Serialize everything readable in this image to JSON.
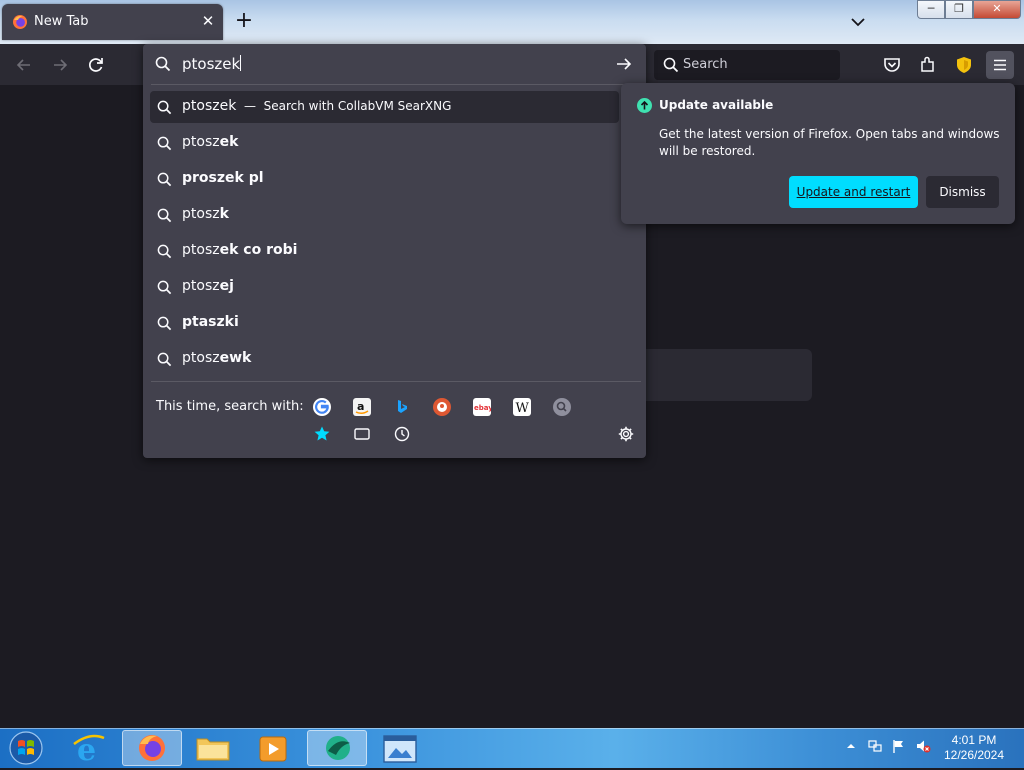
{
  "browser": {
    "tab": {
      "title": "New Tab"
    },
    "window_controls": {
      "minimize": "─",
      "maximize": "❐",
      "close": "✕"
    },
    "new_tab_symbol": "+"
  },
  "urlbar": {
    "value": "ptoszek",
    "results": [
      {
        "type": "search-action",
        "prefix": "ptoszek",
        "bold": "",
        "separator": "—",
        "action": "Search with CollabVM SearXNG",
        "selected": true
      },
      {
        "type": "suggestion",
        "prefix": "ptosz",
        "bold": "ek"
      },
      {
        "type": "suggestion",
        "prefix": "",
        "bold": "proszek pl"
      },
      {
        "type": "suggestion",
        "prefix": "ptosz",
        "bold": "k"
      },
      {
        "type": "suggestion",
        "prefix": "ptosz",
        "bold": "ek co robi"
      },
      {
        "type": "suggestion",
        "prefix": "ptosz",
        "bold": "ej"
      },
      {
        "type": "suggestion",
        "prefix": "",
        "bold": "ptaszki"
      },
      {
        "type": "suggestion",
        "prefix": "ptosz",
        "bold": "ewk"
      }
    ],
    "one_off": {
      "label": "This time, search with:",
      "engines": [
        {
          "name": "google",
          "icon": "google-icon"
        },
        {
          "name": "amazon",
          "icon": "amazon-icon"
        },
        {
          "name": "bing",
          "icon": "bing-icon"
        },
        {
          "name": "duckduckgo",
          "icon": "duckduckgo-icon"
        },
        {
          "name": "ebay",
          "icon": "ebay-icon",
          "glyph": "ebay"
        },
        {
          "name": "wikipedia",
          "icon": "wikipedia-icon",
          "glyph": "W"
        },
        {
          "name": "searxng",
          "icon": "searxng-icon"
        }
      ],
      "modes": [
        {
          "name": "bookmarks",
          "icon": "star-icon"
        },
        {
          "name": "tabs",
          "icon": "tabs-icon"
        },
        {
          "name": "history",
          "icon": "clock-icon"
        }
      ],
      "settings_icon": "gear-icon"
    }
  },
  "searchbar": {
    "placeholder": "Search"
  },
  "update_doorhanger": {
    "title": "Update available",
    "message": "Get the latest version of Firefox. Open tabs and windows will be restored.",
    "primary": "Update and restart",
    "secondary": "Dismiss"
  },
  "taskbar": {
    "items": [
      "internet-explorer",
      "firefox",
      "file-explorer",
      "media-player",
      "collabvm",
      "desktop-window"
    ],
    "clock": {
      "time": "4:01 PM",
      "date": "12/26/2024"
    }
  },
  "colors": {
    "accent": "#00ddff",
    "update_icon": "#3fe1b0",
    "panel": "#42414d",
    "toolbar": "#2b2a33",
    "content": "#1c1b22"
  }
}
